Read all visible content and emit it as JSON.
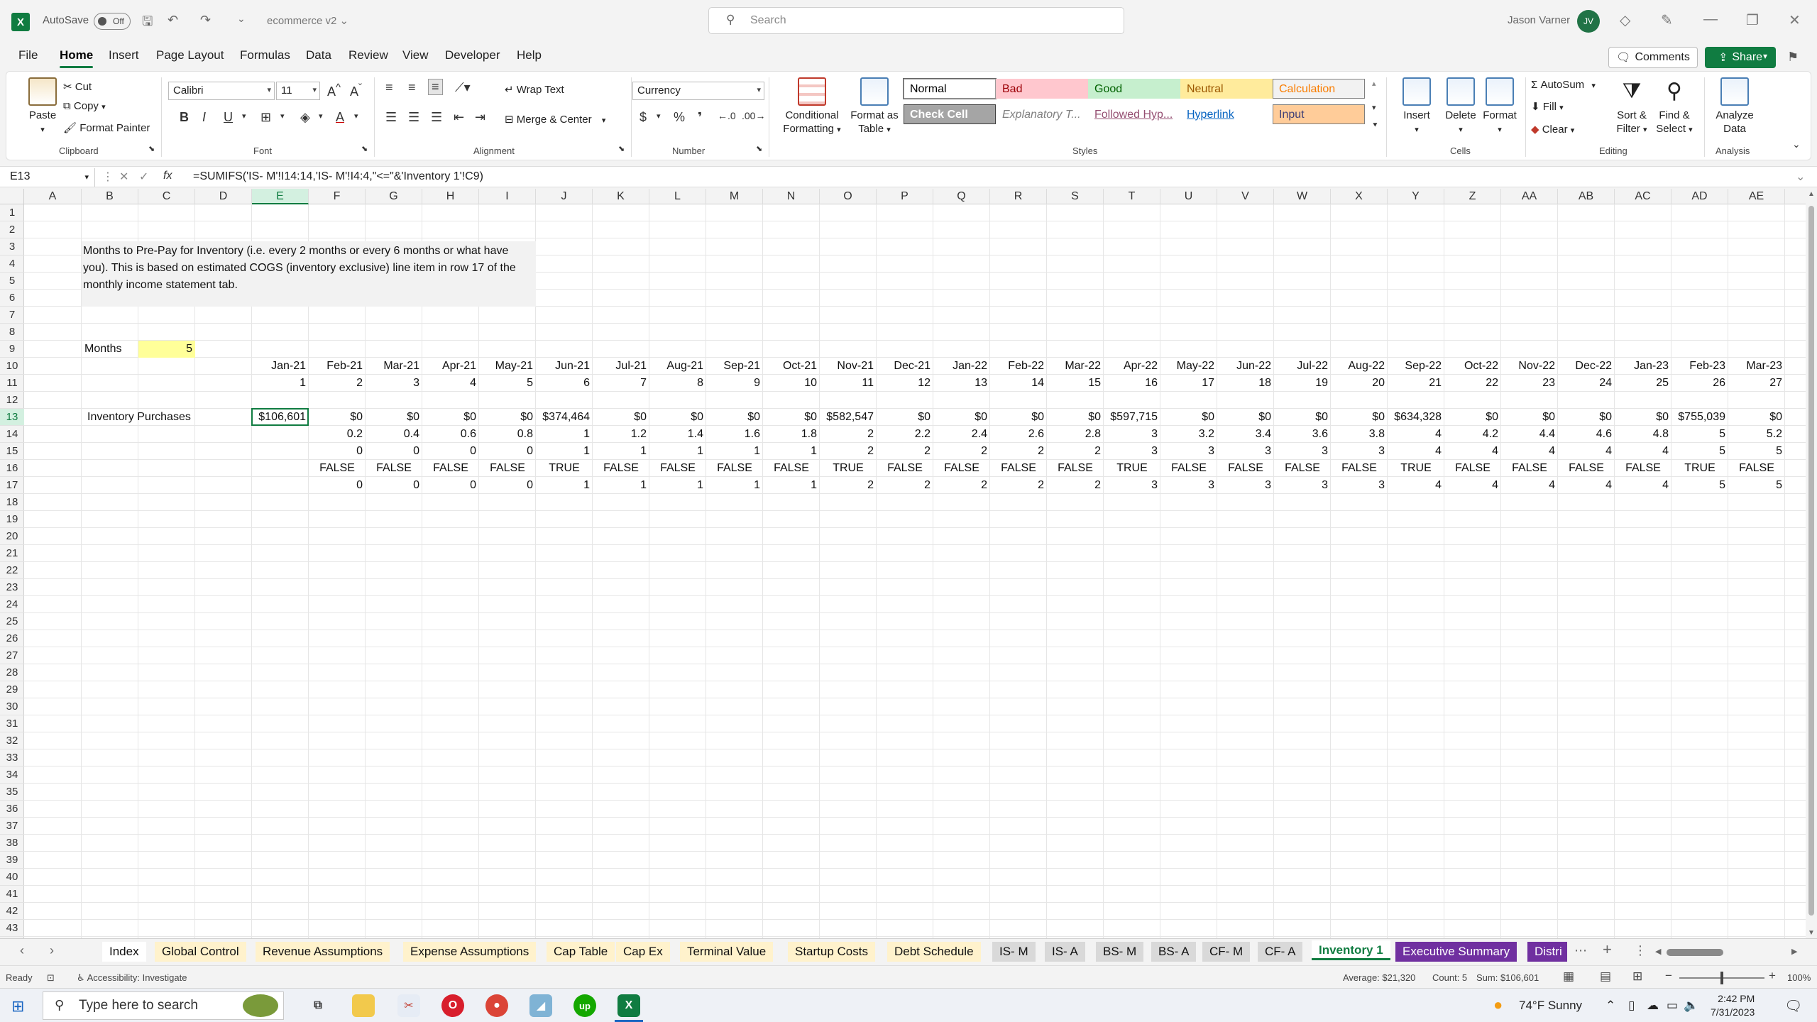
{
  "titlebar": {
    "autosave_label": "AutoSave",
    "autosave_state": "Off",
    "doc_name": "ecommerce v2",
    "search_placeholder": "Search",
    "user_name": "Jason Varner",
    "user_initials": "JV"
  },
  "menu": {
    "tabs": [
      "File",
      "Home",
      "Insert",
      "Page Layout",
      "Formulas",
      "Data",
      "Review",
      "View",
      "Developer",
      "Help"
    ],
    "comments_label": "Comments",
    "share_label": "Share"
  },
  "ribbon": {
    "paste": "Paste",
    "cut": "Cut",
    "copy": "Copy",
    "format_painter": "Format Painter",
    "clipboard_group": "Clipboard",
    "font_name": "Calibri",
    "font_size": "11",
    "font_group": "Font",
    "wrap_text": "Wrap Text",
    "merge_center": "Merge & Center",
    "alignment_group": "Alignment",
    "number_format": "Currency",
    "number_group": "Number",
    "conditional_formatting": "Conditional Formatting",
    "format_as_table": "Format as Table",
    "styles": [
      {
        "label": "Normal",
        "bg": "#ffffff",
        "fg": "#000000",
        "border": "#9a9a9a"
      },
      {
        "label": "Bad",
        "bg": "#ffc7ce",
        "fg": "#9c0006",
        "border": "#ffc7ce"
      },
      {
        "label": "Good",
        "bg": "#c6efce",
        "fg": "#006100",
        "border": "#c6efce"
      },
      {
        "label": "Neutral",
        "bg": "#ffeb9c",
        "fg": "#9c5700",
        "border": "#ffeb9c"
      },
      {
        "label": "Calculation",
        "bg": "#f2f2f2",
        "fg": "#fa7d00",
        "border": "#7f7f7f"
      },
      {
        "label": "Check Cell",
        "bg": "#a5a5a5",
        "fg": "#ffffff",
        "border": "#3f3f3f"
      },
      {
        "label": "Explanatory T...",
        "bg": "#ffffff",
        "fg": "#7f7f7f",
        "border": "#ffffff"
      },
      {
        "label": "Followed Hyp...",
        "bg": "#ffffff",
        "fg": "#954f72",
        "border": "#ffffff"
      },
      {
        "label": "Hyperlink",
        "bg": "#ffffff",
        "fg": "#0563c1",
        "border": "#ffffff"
      },
      {
        "label": "Input",
        "bg": "#ffcc99",
        "fg": "#3f3f76",
        "border": "#7f7f7f"
      }
    ],
    "styles_group": "Styles",
    "insert": "Insert",
    "delete": "Delete",
    "format": "Format",
    "cells_group": "Cells",
    "autosum": "AutoSum",
    "fill": "Fill",
    "clear": "Clear",
    "sort_filter": "Sort & Filter",
    "find_select": "Find & Select",
    "editing_group": "Editing",
    "analyze_data": "Analyze Data",
    "analysis_group": "Analysis"
  },
  "formula_bar": {
    "name_box": "E13",
    "formula": "=SUMIFS('IS- M'!I14:14,'IS- M'!I4:4,\"<=\"&'Inventory 1'!C9)"
  },
  "grid": {
    "columns": [
      "A",
      "B",
      "C",
      "D",
      "E",
      "F",
      "G",
      "H",
      "I",
      "J",
      "K",
      "L",
      "M",
      "N",
      "O",
      "P",
      "Q",
      "R",
      "S",
      "T",
      "U",
      "V",
      "W",
      "X",
      "Y",
      "Z",
      "AA",
      "AB",
      "AC",
      "AD",
      "AE"
    ],
    "row_count": 43,
    "note_lines": [
      "Months to Pre-Pay for Inventory (i.e. every 2 months or every 6 months or what have",
      "you). This is based on estimated COGS (inventory exclusive) line item in row 17 of the",
      "monthly income statement tab."
    ],
    "months_label": "Months",
    "months_value": "5",
    "inventory_label": "Inventory Purchases",
    "dates": [
      "Jan-21",
      "Feb-21",
      "Mar-21",
      "Apr-21",
      "May-21",
      "Jun-21",
      "Jul-21",
      "Aug-21",
      "Sep-21",
      "Oct-21",
      "Nov-21",
      "Dec-21",
      "Jan-22",
      "Feb-22",
      "Mar-22",
      "Apr-22",
      "May-22",
      "Jun-22",
      "Jul-22",
      "Aug-22",
      "Sep-22",
      "Oct-22",
      "Nov-22",
      "Dec-22",
      "Jan-23",
      "Feb-23",
      "Mar-23"
    ],
    "row11": [
      "1",
      "2",
      "3",
      "4",
      "5",
      "6",
      "7",
      "8",
      "9",
      "10",
      "11",
      "12",
      "13",
      "14",
      "15",
      "16",
      "17",
      "18",
      "19",
      "20",
      "21",
      "22",
      "23",
      "24",
      "25",
      "26",
      "27"
    ],
    "row13": [
      "$106,601",
      "$0",
      "$0",
      "$0",
      "$0",
      "$374,464",
      "$0",
      "$0",
      "$0",
      "$0",
      "$582,547",
      "$0",
      "$0",
      "$0",
      "$0",
      "$597,715",
      "$0",
      "$0",
      "$0",
      "$0",
      "$634,328",
      "$0",
      "$0",
      "$0",
      "$0",
      "$755,039",
      "$0"
    ],
    "row14": [
      "",
      "0.2",
      "0.4",
      "0.6",
      "0.8",
      "1",
      "1.2",
      "1.4",
      "1.6",
      "1.8",
      "2",
      "2.2",
      "2.4",
      "2.6",
      "2.8",
      "3",
      "3.2",
      "3.4",
      "3.6",
      "3.8",
      "4",
      "4.2",
      "4.4",
      "4.6",
      "4.8",
      "5",
      "5.2"
    ],
    "row15": [
      "",
      "0",
      "0",
      "0",
      "0",
      "1",
      "1",
      "1",
      "1",
      "1",
      "2",
      "2",
      "2",
      "2",
      "2",
      "3",
      "3",
      "3",
      "3",
      "3",
      "4",
      "4",
      "4",
      "4",
      "4",
      "5",
      "5"
    ],
    "row16": [
      "",
      "FALSE",
      "FALSE",
      "FALSE",
      "FALSE",
      "TRUE",
      "FALSE",
      "FALSE",
      "FALSE",
      "FALSE",
      "TRUE",
      "FALSE",
      "FALSE",
      "FALSE",
      "FALSE",
      "TRUE",
      "FALSE",
      "FALSE",
      "FALSE",
      "FALSE",
      "TRUE",
      "FALSE",
      "FALSE",
      "FALSE",
      "FALSE",
      "TRUE",
      "FALSE"
    ],
    "row17": [
      "",
      "0",
      "0",
      "0",
      "0",
      "1",
      "1",
      "1",
      "1",
      "1",
      "2",
      "2",
      "2",
      "2",
      "2",
      "3",
      "3",
      "3",
      "3",
      "3",
      "4",
      "4",
      "4",
      "4",
      "4",
      "5",
      "5"
    ]
  },
  "sheets": [
    {
      "name": "Index",
      "bg": "#ffffff",
      "fg": "#111111"
    },
    {
      "name": "Global Control",
      "bg": "#fff2cc",
      "fg": "#111111"
    },
    {
      "name": "Revenue Assumptions",
      "bg": "#fff2cc",
      "fg": "#111111"
    },
    {
      "name": "Expense Assumptions",
      "bg": "#fff2cc",
      "fg": "#111111"
    },
    {
      "name": "Cap Table",
      "bg": "#fff2cc",
      "fg": "#111111"
    },
    {
      "name": "Cap Ex",
      "bg": "#fff2cc",
      "fg": "#111111"
    },
    {
      "name": "Terminal Value",
      "bg": "#fff2cc",
      "fg": "#111111"
    },
    {
      "name": "Startup Costs",
      "bg": "#fff2cc",
      "fg": "#111111"
    },
    {
      "name": "Debt Schedule",
      "bg": "#fff2cc",
      "fg": "#111111"
    },
    {
      "name": "IS- M",
      "bg": "#d9d9d9",
      "fg": "#111111"
    },
    {
      "name": "IS- A",
      "bg": "#d9d9d9",
      "fg": "#111111"
    },
    {
      "name": "BS- M",
      "bg": "#d9d9d9",
      "fg": "#111111"
    },
    {
      "name": "BS- A",
      "bg": "#d9d9d9",
      "fg": "#111111"
    },
    {
      "name": "CF- M",
      "bg": "#d9d9d9",
      "fg": "#111111"
    },
    {
      "name": "CF- A",
      "bg": "#d9d9d9",
      "fg": "#111111"
    },
    {
      "name": "Inventory 1",
      "bg": "#ffffff",
      "fg": "#107c41"
    },
    {
      "name": "Executive Summary",
      "bg": "#7030a0",
      "fg": "#ffffff"
    },
    {
      "name": "Distri",
      "bg": "#7030a0",
      "fg": "#ffffff"
    }
  ],
  "status": {
    "ready": "Ready",
    "accessibility": "Accessibility: Investigate",
    "average": "Average: $21,320",
    "count": "Count: 5",
    "sum": "Sum: $106,601",
    "zoom": "100%"
  },
  "taskbar": {
    "search_placeholder": "Type here to search",
    "weather": "74°F  Sunny",
    "time": "2:42 PM",
    "date": "7/31/2023"
  }
}
